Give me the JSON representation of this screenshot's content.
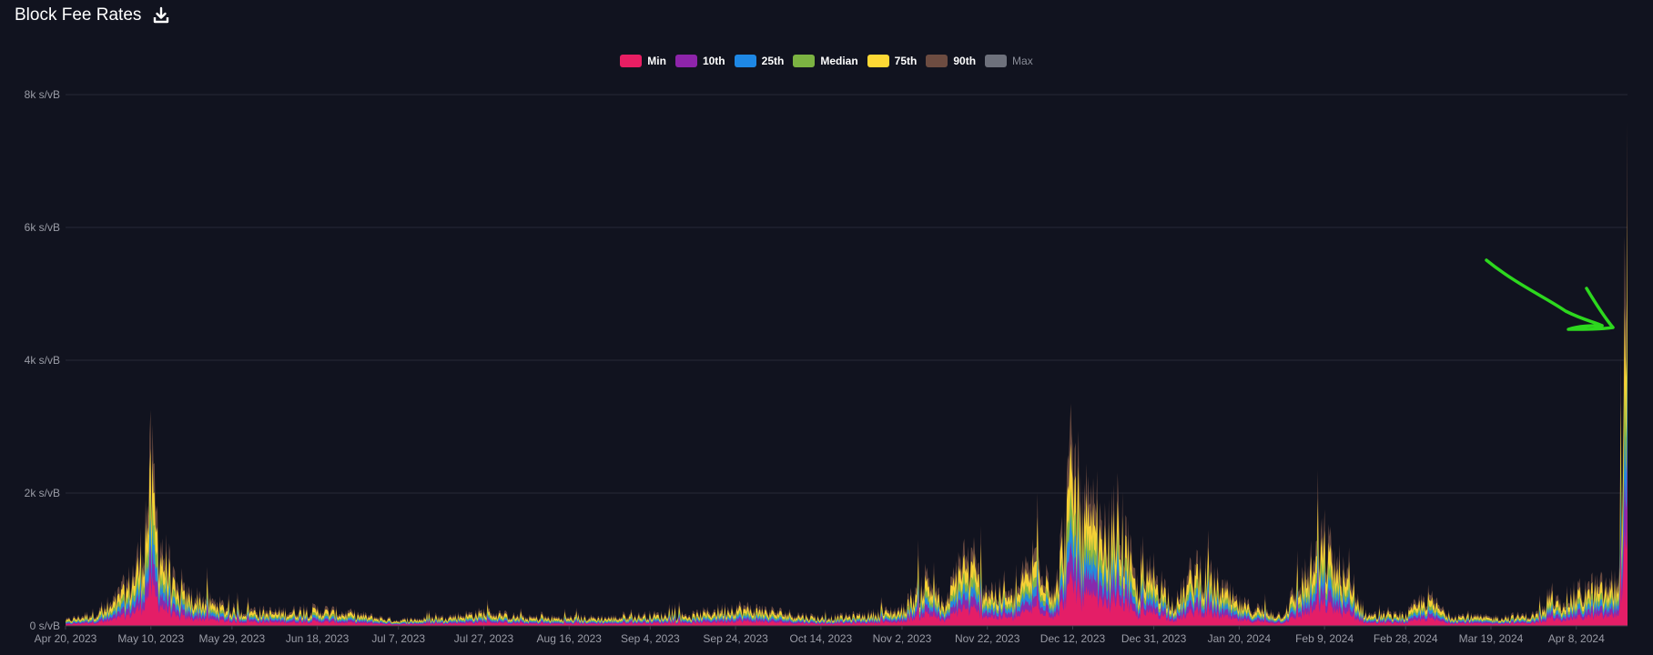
{
  "header": {
    "title": "Block Fee Rates",
    "download_icon": "download-icon"
  },
  "colors": {
    "background": "#11131f",
    "grid": "#262937",
    "annotation": "#2dd81e"
  },
  "legend": [
    {
      "name": "Min",
      "color": "#e91e63",
      "enabled": true
    },
    {
      "name": "10th",
      "color": "#8e24aa",
      "enabled": true
    },
    {
      "name": "25th",
      "color": "#1e88e5",
      "enabled": true
    },
    {
      "name": "Median",
      "color": "#7cb342",
      "enabled": true
    },
    {
      "name": "75th",
      "color": "#fdd835",
      "enabled": true
    },
    {
      "name": "90th",
      "color": "#6d4c41",
      "enabled": true
    },
    {
      "name": "Max",
      "color": "#6e717c",
      "enabled": false
    }
  ],
  "chart_data": {
    "type": "area",
    "stacked": true,
    "title": "Block Fee Rates",
    "ylabel_unit": "s/vB",
    "ylim": [
      0,
      8000
    ],
    "yticks": [
      {
        "value": 0,
        "label": "0 s/vB"
      },
      {
        "value": 2000,
        "label": "2k s/vB"
      },
      {
        "value": 4000,
        "label": "4k s/vB"
      },
      {
        "value": 6000,
        "label": "6k s/vB"
      },
      {
        "value": 8000,
        "label": "8k s/vB"
      }
    ],
    "xticks": [
      "Apr 20, 2023",
      "May 10, 2023",
      "May 29, 2023",
      "Jun 18, 2023",
      "Jul 7, 2023",
      "Jul 27, 2023",
      "Aug 16, 2023",
      "Sep 4, 2023",
      "Sep 24, 2023",
      "Oct 14, 2023",
      "Nov 2, 2023",
      "Nov 22, 2023",
      "Dec 12, 2023",
      "Dec 31, 2023",
      "Jan 20, 2024",
      "Feb 9, 2024",
      "Feb 28, 2024",
      "Mar 19, 2024",
      "Apr 8, 2024"
    ],
    "grid": true,
    "legend_position": "top-center",
    "series_names": [
      "Min",
      "10th",
      "25th",
      "Median",
      "75th",
      "90th"
    ],
    "total_envelope": {
      "x": [
        "Apr 20, 2023",
        "Apr 30, 2023",
        "May 5, 2023",
        "May 8, 2023",
        "May 10, 2023",
        "May 12, 2023",
        "May 16, 2023",
        "May 22, 2023",
        "May 29, 2023",
        "Jun 8, 2023",
        "Jun 18, 2023",
        "Jun 28, 2023",
        "Jul 7, 2023",
        "Jul 17, 2023",
        "Jul 27, 2023",
        "Aug 6, 2023",
        "Aug 16, 2023",
        "Aug 26, 2023",
        "Sep 4, 2023",
        "Sep 14, 2023",
        "Sep 24, 2023",
        "Oct 4, 2023",
        "Oct 14, 2023",
        "Oct 24, 2023",
        "Nov 2, 2023",
        "Nov 8, 2023",
        "Nov 12, 2023",
        "Nov 16, 2023",
        "Nov 22, 2023",
        "Nov 28, 2023",
        "Dec 4, 2023",
        "Dec 8, 2023",
        "Dec 12, 2023",
        "Dec 14, 2023",
        "Dec 16, 2023",
        "Dec 19, 2023",
        "Dec 23, 2023",
        "Dec 27, 2023",
        "Dec 31, 2023",
        "Jan 5, 2024",
        "Jan 10, 2024",
        "Jan 20, 2024",
        "Jan 30, 2024",
        "Feb 9, 2024",
        "Feb 19, 2024",
        "Feb 28, 2024",
        "Mar 4, 2024",
        "Mar 9, 2024",
        "Mar 19, 2024",
        "Mar 29, 2024",
        "Apr 8, 2024",
        "Apr 12, 2024",
        "Apr 16, 2024",
        "Apr 18, 2024",
        "Apr 20, 2024"
      ],
      "values": [
        100,
        300,
        800,
        1400,
        2800,
        1600,
        600,
        500,
        300,
        250,
        300,
        200,
        100,
        150,
        250,
        150,
        150,
        150,
        200,
        200,
        350,
        250,
        150,
        200,
        300,
        900,
        300,
        1300,
        700,
        500,
        1400,
        600,
        3100,
        1800,
        2000,
        1500,
        2000,
        700,
        1000,
        400,
        1100,
        400,
        200,
        1500,
        200,
        200,
        550,
        200,
        150,
        200,
        600,
        700,
        700,
        900,
        7600
      ]
    },
    "annotation": {
      "type": "arrow",
      "text": "",
      "points_to": "Apr 20, 2024"
    }
  }
}
